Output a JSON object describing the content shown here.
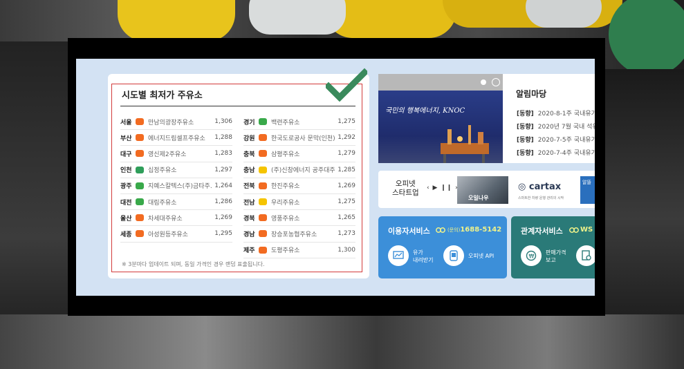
{
  "left_card": {
    "title": "시도별 최저가 주유소",
    "left_rows": [
      {
        "region": "서울",
        "name": "만남의광장주유소",
        "price": "1,306",
        "brand_color": "#f26b21"
      },
      {
        "region": "부산",
        "name": "에너지드림셀프주유소",
        "price": "1,288",
        "brand_color": "#f26b21"
      },
      {
        "region": "대구",
        "name": "영신제2주유소",
        "price": "1,283",
        "brand_color": "#f26b21"
      },
      {
        "region": "인천",
        "name": "십정주유소",
        "price": "1,297",
        "brand_color": "#2f9e5a"
      },
      {
        "region": "광주",
        "name": "지예스칼텍스(주)금타주...",
        "price": "1,264",
        "brand_color": "#39a94a"
      },
      {
        "region": "대전",
        "name": "대림주유소",
        "price": "1,286",
        "brand_color": "#39a94a"
      },
      {
        "region": "울산",
        "name": "차세대주유소",
        "price": "1,269",
        "brand_color": "#f26b21"
      },
      {
        "region": "세종",
        "name": "아성원등주유소",
        "price": "1,295",
        "brand_color": "#f26b21"
      }
    ],
    "right_rows": [
      {
        "region": "경기",
        "name": "백련주유소",
        "price": "1,275",
        "brand_color": "#39a94a"
      },
      {
        "region": "강원",
        "name": "한국도로공사 문막(인천)...",
        "price": "1,292",
        "brand_color": "#f26b21"
      },
      {
        "region": "충북",
        "name": "삼평주유소",
        "price": "1,279",
        "brand_color": "#f26b21"
      },
      {
        "region": "충남",
        "name": "(주)신창에너지 공주대주...",
        "price": "1,285",
        "brand_color": "#f5c400"
      },
      {
        "region": "전북",
        "name": "한진주유소",
        "price": "1,269",
        "brand_color": "#f26b21"
      },
      {
        "region": "전남",
        "name": "우리주유소",
        "price": "1,275",
        "brand_color": "#f5c400"
      },
      {
        "region": "경북",
        "name": "영풍주유소",
        "price": "1,265",
        "brand_color": "#f26b21"
      },
      {
        "region": "경남",
        "name": "장승포농협주유소",
        "price": "1,273",
        "brand_color": "#f26b21"
      },
      {
        "region": "제주",
        "name": "도평주유소",
        "price": "1,300",
        "brand_color": "#f26b21"
      }
    ],
    "note": "※ 3분마다 업데이트 되며, 동일 가격인 경우 랜덤 표출됩니다."
  },
  "banner": {
    "text": "국민의 행복에너지, KNOC"
  },
  "notice": {
    "title": "알림마당",
    "items": [
      {
        "tag": "[동향]",
        "text": "2020-8-1주 국내유가"
      },
      {
        "tag": "[동향]",
        "text": "2020년 7월 국내 석유"
      },
      {
        "tag": "[동향]",
        "text": "2020-7-5주 국내유가"
      },
      {
        "tag": "[동향]",
        "text": "2020-7-4주 국내유가"
      }
    ]
  },
  "strip": {
    "label_line1": "오피넷",
    "label_line2": "스타트업",
    "arrows": "‹ ▶ ❙❙ ›",
    "tile1_text": "오일나우",
    "tile2_title": "cartax",
    "tile2_sub": "스마트한 차량 운행 관리의 시작",
    "tile3_text": "알뜰"
  },
  "user_service": {
    "title": "이용자서비스",
    "phone_prefix": "(문의)",
    "phone": "1688-5142",
    "btn1": "유가\n내려받기",
    "btn1_line1": "유가",
    "btn1_line2": "내려받기",
    "btn2": "오피넷 API"
  },
  "partner_service": {
    "title": "관계자서비스",
    "link_text": "WS",
    "btn1_line1": "판매가격",
    "btn1_line2": "보고"
  },
  "colors": {
    "blue_box": "#3c8fd9",
    "teal_box": "#2a7a78",
    "highlight_red": "#d23a3a",
    "check_green": "#3a8a5c"
  }
}
